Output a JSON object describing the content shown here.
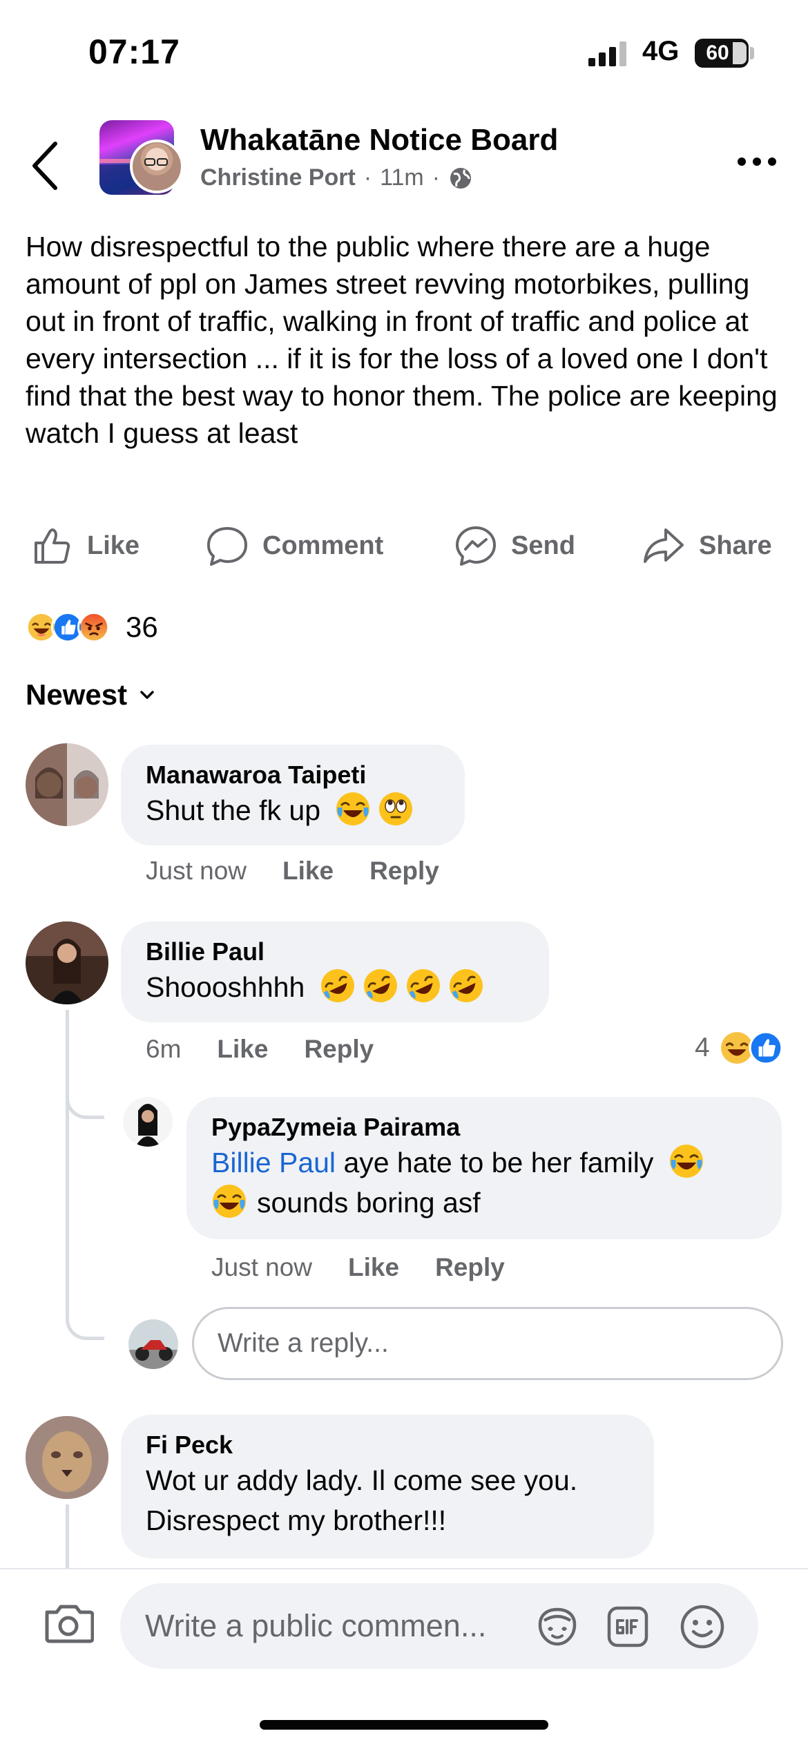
{
  "status_bar": {
    "time": "07:17",
    "network": "4G",
    "battery": "60"
  },
  "header": {
    "group_name": "Whakatāne Notice Board",
    "author": "Christine Port",
    "time": "11m",
    "separator": "·",
    "audience_icon": "globe-icon"
  },
  "post": {
    "text": "How disrespectful to the public where there are a huge amount of ppl on James street revving motorbikes, pulling out in front of traffic, walking in front of traffic and police at every intersection  ... if it is for the loss of a loved one I don't find that the best way to honor them. The police are keeping watch I guess at least"
  },
  "actions": {
    "like": "Like",
    "comment": "Comment",
    "send": "Send",
    "share": "Share"
  },
  "reactions": {
    "count": "36",
    "types": [
      "haha",
      "like",
      "angry"
    ]
  },
  "sort": {
    "label": "Newest"
  },
  "comments": [
    {
      "name": "Manawaroa Taipeti",
      "text": "Shut the fk up",
      "emojis": [
        "joy",
        "eye-roll"
      ],
      "time": "Just now",
      "like": "Like",
      "reply": "Reply"
    },
    {
      "name": "Billie Paul",
      "text": "Shoooshhhh",
      "emojis": [
        "rofl",
        "rofl",
        "rofl",
        "rofl"
      ],
      "time": "6m",
      "like": "Like",
      "reply": "Reply",
      "reaction_count": "4",
      "replies": [
        {
          "name": "PypaZymeia Pairama",
          "mention": "Billie Paul",
          "text_line1": " aye hate to be her family",
          "text_line2": "sounds boring asf",
          "time": "Just now",
          "like": "Like",
          "reply": "Reply"
        }
      ],
      "reply_placeholder": "Write a reply..."
    },
    {
      "name": "Fi Peck",
      "text_line1": "Wot ur addy lady. Il come see you.",
      "text_line2": "Disrespect my brother!!!"
    }
  ],
  "composer": {
    "placeholder": "Write a public commen..."
  },
  "colors": {
    "link": "#1a66d2",
    "bubble": "#f0f2f5",
    "secondary_text": "#65676b",
    "like_blue": "#1877f2"
  }
}
